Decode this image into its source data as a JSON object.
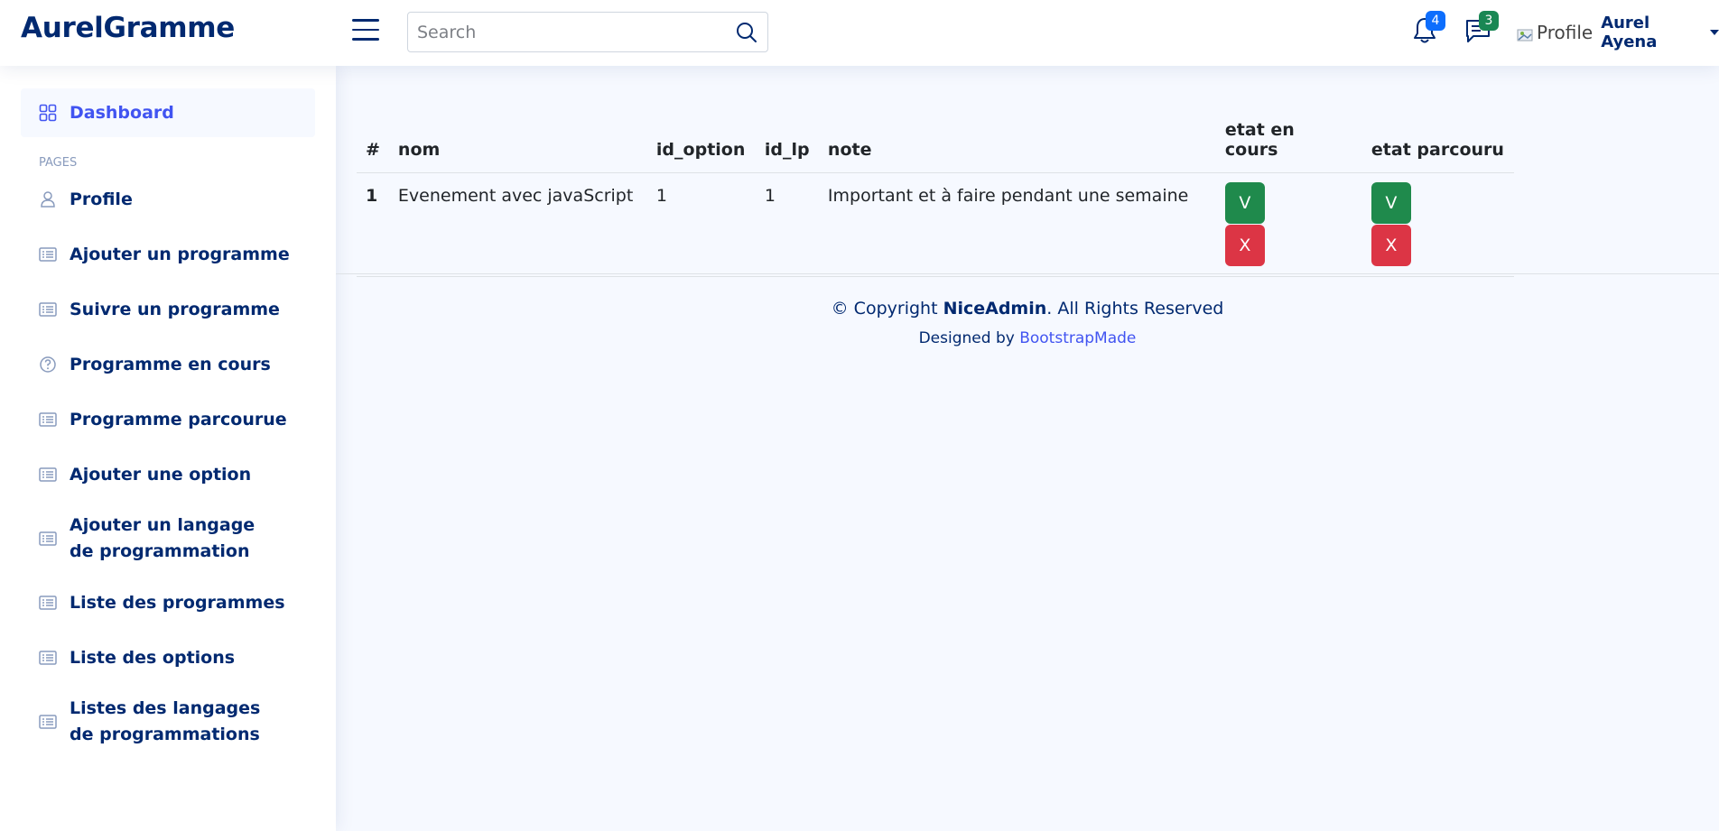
{
  "header": {
    "logo": "AurelGramme",
    "search_placeholder": "Search",
    "notifications_count": "4",
    "messages_count": "3",
    "profile_img_alt": "Profile",
    "user_name": "Aurel Ayena"
  },
  "sidebar": {
    "dashboard": "Dashboard",
    "heading": "PAGES",
    "items": [
      {
        "label": "Profile",
        "icon": "person-icon"
      },
      {
        "label": "Ajouter un programme",
        "icon": "card-list-icon"
      },
      {
        "label": "Suivre un programme",
        "icon": "card-list-icon"
      },
      {
        "label": "Programme en cours",
        "icon": "question-circle-icon"
      },
      {
        "label": "Programme parcourue",
        "icon": "card-list-icon"
      },
      {
        "label": "Ajouter une option",
        "icon": "card-list-icon"
      },
      {
        "label": "Ajouter un langage de programmation",
        "icon": "card-list-icon"
      },
      {
        "label": "Liste des programmes",
        "icon": "card-list-icon"
      },
      {
        "label": "Liste des options",
        "icon": "card-list-icon"
      },
      {
        "label": "Listes des langages de programmations",
        "icon": "card-list-icon"
      }
    ]
  },
  "table": {
    "headers": [
      "#",
      "nom",
      "id_option",
      "id_lp",
      "note",
      "etat en cours",
      "etat parcouru"
    ],
    "rows": [
      {
        "num": "1",
        "nom": "Evenement avec javaScript",
        "id_option": "1",
        "id_lp": "1",
        "note": "Important et à faire pendant une semaine",
        "yes": "V",
        "no": "X"
      }
    ]
  },
  "footer": {
    "copyright_prefix": "© Copyright ",
    "brand": "NiceAdmin",
    "copyright_suffix": ". All Rights Reserved",
    "designed_by": "Designed by ",
    "designer": "BootstrapMade"
  },
  "colors": {
    "primary": "#4154f1",
    "navy": "#012970",
    "success": "#198754",
    "danger": "#dc3545"
  }
}
